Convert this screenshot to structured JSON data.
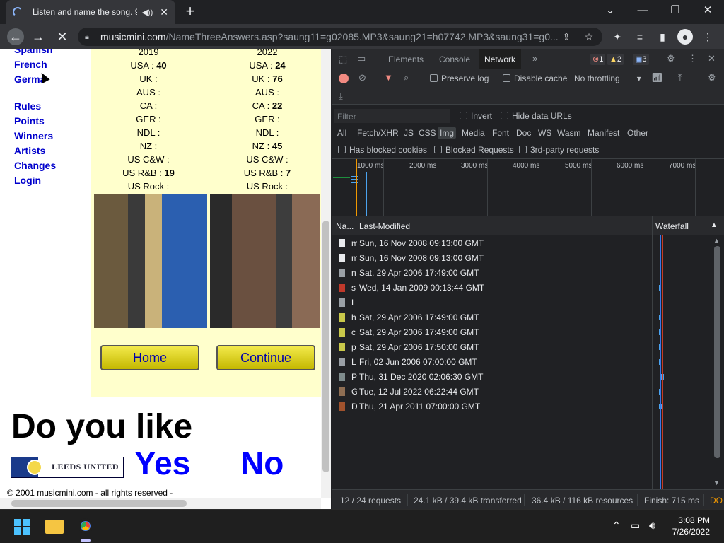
{
  "browser": {
    "tab_title": "Listen and name the song. 9",
    "url_host": "musicmini.com",
    "url_path": "/NameThreeAnswers.asp?saung11=g02085.MP3&saung21=h07742.MP3&saung31=g0..."
  },
  "page": {
    "nav": [
      {
        "label": "Spanish"
      },
      {
        "label": "French"
      },
      {
        "label": "German"
      },
      {
        "label": "Rules"
      },
      {
        "label": "Points"
      },
      {
        "label": "Winners"
      },
      {
        "label": "Artists"
      },
      {
        "label": "Changes"
      },
      {
        "label": "Login"
      }
    ],
    "left_col": {
      "year": "2019",
      "rows": [
        {
          "label": "USA :",
          "value": "40"
        },
        {
          "label": "UK :",
          "value": ""
        },
        {
          "label": "AUS :",
          "value": ""
        },
        {
          "label": "CA :",
          "value": ""
        },
        {
          "label": "GER :",
          "value": ""
        },
        {
          "label": "NDL :",
          "value": ""
        },
        {
          "label": "NZ :",
          "value": ""
        },
        {
          "label": "US C&W :",
          "value": ""
        },
        {
          "label": "US R&B :",
          "value": "19"
        },
        {
          "label": "US Rock :",
          "value": ""
        }
      ]
    },
    "right_col": {
      "year": "2022",
      "rows": [
        {
          "label": "USA :",
          "value": "24"
        },
        {
          "label": "UK :",
          "value": "76"
        },
        {
          "label": "AUS :",
          "value": ""
        },
        {
          "label": "CA :",
          "value": "22"
        },
        {
          "label": "GER :",
          "value": ""
        },
        {
          "label": "NDL :",
          "value": ""
        },
        {
          "label": "NZ :",
          "value": "45"
        },
        {
          "label": "US C&W :",
          "value": ""
        },
        {
          "label": "US R&B :",
          "value": "7"
        },
        {
          "label": "US Rock :",
          "value": ""
        }
      ]
    },
    "home_label": "Home",
    "continue_label": "Continue",
    "question": "Do you like",
    "leeds_text": "LEEDS UNITED",
    "yes_label": "Yes",
    "no_label": "No",
    "copyright": "© 2001 musicmini.com - all rights reserved -"
  },
  "devtools": {
    "tabs": [
      "Elements",
      "Console",
      "Network"
    ],
    "active_tab": "Network",
    "badges": {
      "errors": "1",
      "warnings": "2",
      "messages": "3"
    },
    "toolbar": {
      "preserve_log": "Preserve log",
      "disable_cache": "Disable cache",
      "throttling": "No throttling"
    },
    "filter_placeholder": "Filter",
    "invert": "Invert",
    "hide_data_urls": "Hide data URLs",
    "types": [
      "All",
      "Fetch/XHR",
      "JS",
      "CSS",
      "Img",
      "Media",
      "Font",
      "Doc",
      "WS",
      "Wasm",
      "Manifest",
      "Other"
    ],
    "selected_type": "Img",
    "has_blocked_cookies": "Has blocked cookies",
    "blocked_requests": "Blocked Requests",
    "third_party": "3rd-party requests",
    "timeline_ticks": [
      "1000 ms",
      "2000 ms",
      "3000 ms",
      "4000 ms",
      "5000 ms",
      "6000 ms",
      "7000 ms"
    ],
    "columns": {
      "name": "Na...",
      "last_modified": "Last-Modified",
      "waterfall": "Waterfall"
    },
    "rows": [
      {
        "name": "m",
        "last_modified": "Sun, 16 Nov 2008 09:13:00 GMT",
        "icon_color": "#e8eaed"
      },
      {
        "name": "m",
        "last_modified": "Sun, 16 Nov 2008 09:13:00 GMT",
        "icon_color": "#e8eaed"
      },
      {
        "name": "n",
        "last_modified": "Sat, 29 Apr 2006 17:49:00 GMT",
        "icon_color": "#9aa0a6"
      },
      {
        "name": "s",
        "last_modified": "Wed, 14 Jan 2009 00:13:44 GMT",
        "icon_color": "#c0392b"
      },
      {
        "name": "L",
        "last_modified": "",
        "icon_color": "#9aa0a6"
      },
      {
        "name": "h",
        "last_modified": "Sat, 29 Apr 2006 17:49:00 GMT",
        "icon_color": "#c9c84a"
      },
      {
        "name": "c",
        "last_modified": "Sat, 29 Apr 2006 17:49:00 GMT",
        "icon_color": "#c9c84a"
      },
      {
        "name": "p",
        "last_modified": "Sat, 29 Apr 2006 17:50:00 GMT",
        "icon_color": "#c9c84a"
      },
      {
        "name": "L",
        "last_modified": "Fri, 02 Jun 2006 07:00:00 GMT",
        "icon_color": "#9aa0a6"
      },
      {
        "name": "P",
        "last_modified": "Thu, 31 Dec 2020 02:06:30 GMT",
        "icon_color": "#7f8c8d"
      },
      {
        "name": "G",
        "last_modified": "Tue, 12 Jul 2022 06:22:44 GMT",
        "icon_color": "#8e6e53"
      },
      {
        "name": "D",
        "last_modified": "Thu, 21 Apr 2011 07:00:00 GMT",
        "icon_color": "#a0522d"
      }
    ],
    "status": {
      "requests": "12 / 24 requests",
      "transferred": "24.1 kB / 39.4 kB transferred",
      "resources": "36.4 kB / 116 kB resources",
      "finish": "Finish: 715 ms",
      "dom": "DO"
    }
  },
  "taskbar": {
    "time": "3:08 PM",
    "date": "7/26/2022"
  }
}
